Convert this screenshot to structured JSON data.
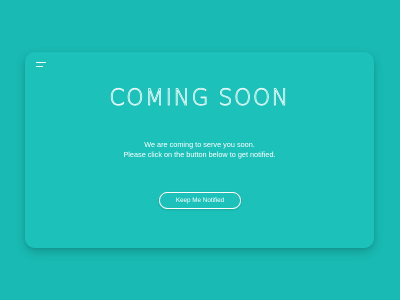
{
  "colors": {
    "background": "#19bab3",
    "card": "#1cc1ba",
    "foreground": "#ffffff"
  },
  "header": {
    "menu_icon": "hamburger-menu-icon"
  },
  "hero": {
    "title": "COMING SOON"
  },
  "message": {
    "line1": "We are coming to serve you soon.",
    "line2": "Please click on the button below to get notified."
  },
  "cta": {
    "label": "Keep Me Notified"
  }
}
